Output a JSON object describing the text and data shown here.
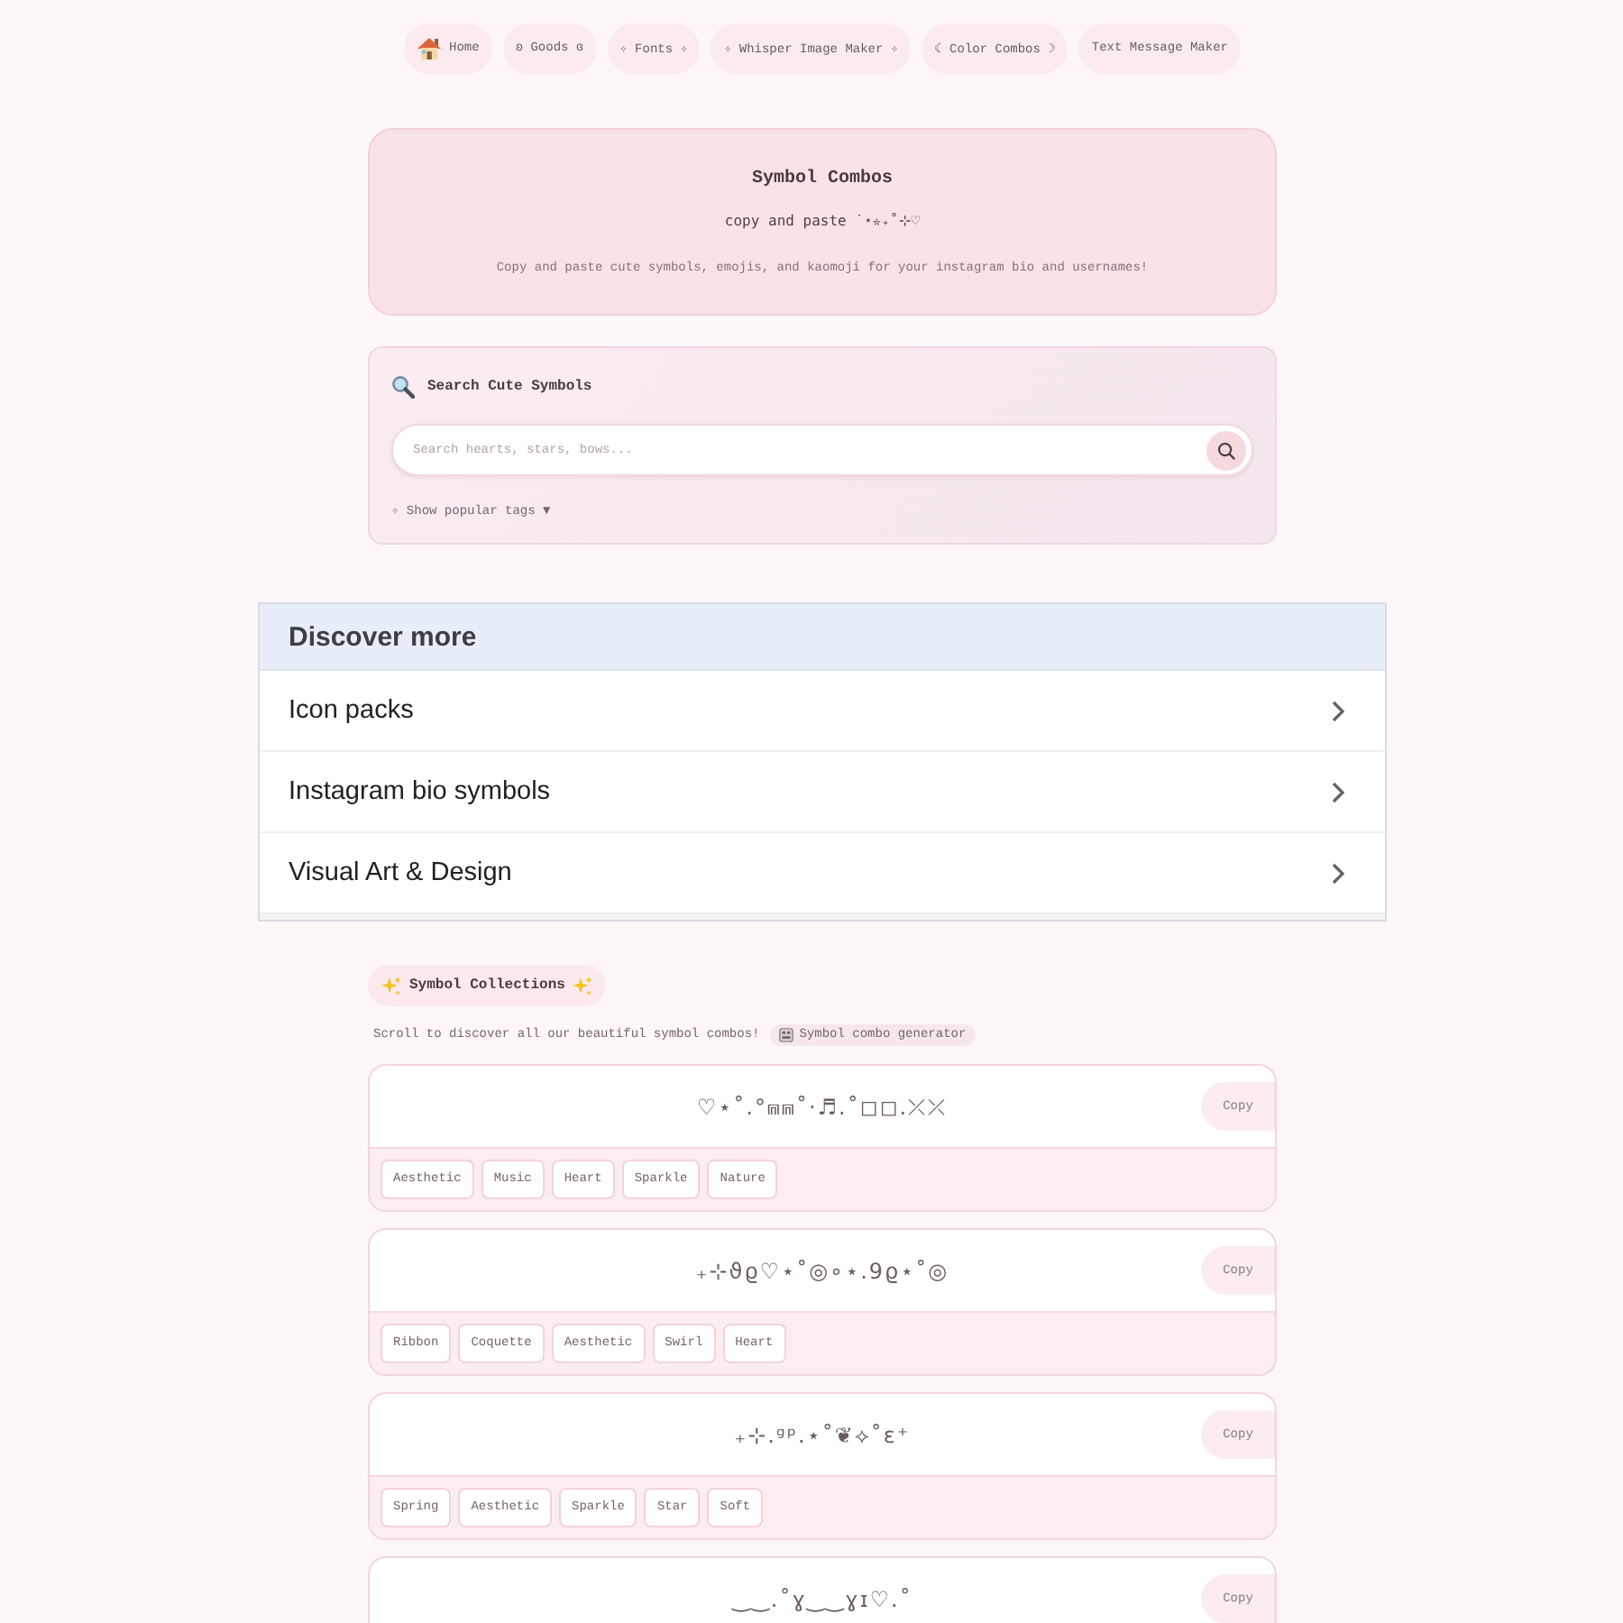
{
  "nav": [
    {
      "kind": "icon",
      "label": "Home"
    },
    {
      "kind": "text",
      "label": "ʚ Goods ɞ"
    },
    {
      "kind": "text",
      "label": "✧ Fonts ✧"
    },
    {
      "kind": "text",
      "label": "✧ Whisper Image Maker ✧"
    },
    {
      "kind": "text",
      "label": "☾ Color Combos ☽"
    },
    {
      "kind": "text",
      "label": "Text Message Maker"
    }
  ],
  "header": {
    "title": "Symbol Combos",
    "subtitle": "copy and paste ˙⋆✮₊˚⊹♡",
    "description": "Copy and paste cute symbols, emojis, and kaomoji for your instagram bio and usernames!"
  },
  "search": {
    "title": "Search Cute Symbols",
    "placeholder": "Search hearts, stars, bows...",
    "toggle": "✧ Show popular tags ▼"
  },
  "discover": {
    "title": "Discover more",
    "items": [
      "Icon packs",
      "Instagram bio symbols",
      "Visual Art & Design"
    ]
  },
  "collections": {
    "title": "Symbol Collections",
    "intro": "Scroll to discover all our beautiful symbol combos!",
    "generator_link": "Symbol combo generator",
    "combos": [
      {
        "symbols": "♡⋆˚.°⩎⩎˚·♬.˚◻◻.⤫⤫",
        "copy": "Copy",
        "tags": [
          "Aesthetic",
          "Music",
          "Heart",
          "Sparkle",
          "Nature"
        ]
      },
      {
        "symbols": "₊⊹ϑϱ♡⋆˚◎∘⋆.9ϱ⋆˚◎",
        "copy": "Copy",
        "tags": [
          "Ribbon",
          "Coquette",
          "Aesthetic",
          "Swirl",
          "Heart"
        ]
      },
      {
        "symbols": "₊⊹.ᵍᵖ.⋆˚❦⟡˚ɛ⁺",
        "copy": "Copy",
        "tags": [
          "Spring",
          "Aesthetic",
          "Sparkle",
          "Star",
          "Soft"
        ]
      },
      {
        "symbols": "‿‿.˚ɣ‿‿ɣɪ♡.˚",
        "copy": "Copy"
      }
    ]
  }
}
